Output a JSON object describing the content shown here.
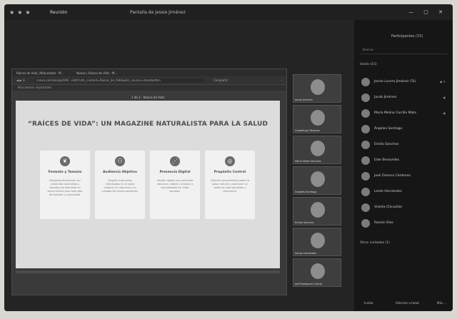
{
  "titlebar": {
    "icons": "◉ ◉ ◉",
    "tab1": "Reunión",
    "tab2": "Pantalla de Jessie Jiménez",
    "window_controls": "— ▢ ✕"
  },
  "browser": {
    "tab_a": "Raíces de Vida | Naturalista - M...",
    "tab_b": "Nuevo | Raíces de Vida - M...",
    "url": "canva.com/design/DAF.../edit?utm_content=Raíces_de_Vida&utm_source=sharebutton",
    "share_label": "Compartir",
    "bookmark": "Marcadores importados"
  },
  "slide": {
    "top_label": "1 de 1 - Raíces de Vida",
    "title": "“RAÍCES DE VIDA”: UN MAGAZINE NATURALISTA PARA LA SALUD",
    "cards": [
      {
        "icon": "❦",
        "title": "Formato y Tamaño",
        "body": "Magazine bimensual con contenido naturalista y consejos de bienestar en salud natural para todo tipo de lectores y comunidad."
      },
      {
        "icon": "⚇",
        "title": "Audiencia Objetivo",
        "body": "Dirigido a personas interesadas en la salud integral, el naturismo y el cuidado del medio ambiente."
      },
      {
        "icon": "⋰",
        "title": "Presencia Digital",
        "body": "Versión digital con contenido adicional, videos y enlaces a comunidades en redes sociales."
      },
      {
        "icon": "◎",
        "title": "Propósito Central",
        "body": "Difundir conocimiento sobre la salud natural y promover un estilo de vida saludable y consciente."
      }
    ]
  },
  "videos": [
    {
      "name": "Jessie Jiménez"
    },
    {
      "name": "Guadalupe Vázquez"
    },
    {
      "name": "María Yáñez Sánchez"
    },
    {
      "name": "Ángeles Santiago"
    },
    {
      "name": "Emilio Sánchez"
    },
    {
      "name": "Sandy Fernández"
    },
    {
      "name": "José Rodríguez García"
    }
  ],
  "panel": {
    "title": "Participantes (15)",
    "search_placeholder": "Buscar",
    "section": "Unido (15)",
    "participants": [
      {
        "name": "Jessie Lucero Jiménez (Tú)",
        "status": "◉ ✎"
      },
      {
        "name": "Jacob Jiménez",
        "status": "◉"
      },
      {
        "name": "María Melina Carrillo Mata",
        "status": "◉"
      },
      {
        "name": "Ángeles Santiago",
        "status": ""
      },
      {
        "name": "Emilio Sánchez",
        "status": ""
      },
      {
        "name": "Eder Benavides",
        "status": ""
      },
      {
        "name": "José Zamora Cárdenas",
        "status": ""
      },
      {
        "name": "Leslie Hernández",
        "status": ""
      },
      {
        "name": "Violeta Chicuellar",
        "status": ""
      },
      {
        "name": "Ramón Ríos",
        "status": ""
      }
    ],
    "others": "Otros invitados (1)",
    "btn_invite": "Invitar",
    "btn_mute": "Silenciar a todos",
    "btn_more": "Más ..."
  }
}
